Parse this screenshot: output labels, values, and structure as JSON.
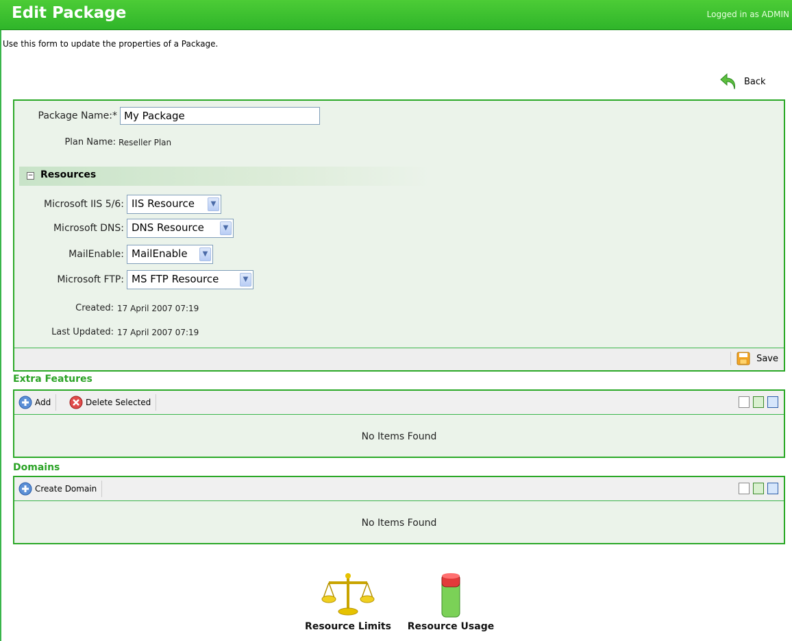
{
  "header": {
    "title": "Edit Package",
    "login_status": "Logged in as ADMIN"
  },
  "description": "Use this form to update the properties of a Package.",
  "back_label": "Back",
  "form": {
    "package_name_label": "Package Name:*",
    "package_name_value": "My Package",
    "plan_name_label": "Plan Name:",
    "plan_name_value": "Reseller Plan",
    "resources_title": "Resources",
    "resources": [
      {
        "label": "Microsoft IIS 5/6:",
        "value": "IIS Resource"
      },
      {
        "label": "Microsoft DNS:",
        "value": "DNS Resource"
      },
      {
        "label": "MailEnable:",
        "value": "MailEnable"
      },
      {
        "label": "Microsoft FTP:",
        "value": "MS FTP Resource"
      }
    ],
    "created_label": "Created:",
    "created_value": "17 April 2007 07:19",
    "updated_label": "Last Updated:",
    "updated_value": "17 April 2007 07:19",
    "save_label": "Save"
  },
  "extra_features": {
    "title": "Extra Features",
    "add_label": "Add",
    "delete_label": "Delete Selected",
    "empty_text": "No Items Found"
  },
  "domains": {
    "title": "Domains",
    "create_label": "Create Domain",
    "empty_text": "No Items Found"
  },
  "links": {
    "resource_limits": "Resource Limits",
    "resource_usage": "Resource Usage"
  },
  "colors": {
    "header_green": "#35b82c",
    "accent_green": "#2ba326",
    "panel_bg": "#ebf3ea"
  }
}
